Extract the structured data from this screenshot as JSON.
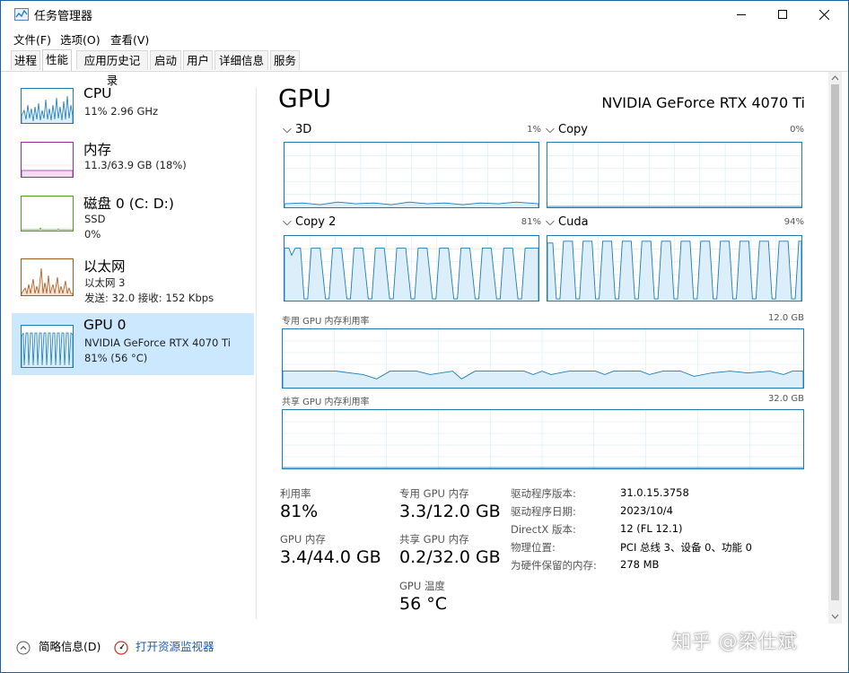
{
  "window": {
    "title": "任务管理器"
  },
  "menu": {
    "file": "文件(F)",
    "options": "选项(O)",
    "view": "查看(V)"
  },
  "tabs": [
    "进程",
    "性能",
    "应用历史记录",
    "启动",
    "用户",
    "详细信息",
    "服务"
  ],
  "active_tab": "性能",
  "sidebar": {
    "items": [
      {
        "title": "CPU",
        "sub1": "11% 2.96 GHz",
        "sub2": "",
        "sub3": "",
        "color": "#1b7cb4"
      },
      {
        "title": "内存",
        "sub1": "11.3/63.9 GB (18%)",
        "sub2": "",
        "sub3": "",
        "color": "#9b2a9b"
      },
      {
        "title": "磁盘 0 (C: D:)",
        "sub1": "SSD",
        "sub2": "0%",
        "sub3": "",
        "color": "#4da01b"
      },
      {
        "title": "以太网",
        "sub1": "以太网 3",
        "sub2": "发送: 32.0 接收: 152 Kbps",
        "sub3": "",
        "color": "#a7581b"
      },
      {
        "title": "GPU 0",
        "sub1": "NVIDIA GeForce RTX 4070 Ti",
        "sub2": "81% (56 °C)",
        "sub3": "",
        "color": "#1b7cb4"
      }
    ]
  },
  "main": {
    "title": "GPU",
    "gpu_name": "NVIDIA GeForce RTX 4070 Ti",
    "engines": [
      {
        "label": "3D",
        "pct": "1%"
      },
      {
        "label": "Copy",
        "pct": "0%"
      },
      {
        "label": "Copy 2",
        "pct": "81%"
      },
      {
        "label": "Cuda",
        "pct": "94%"
      }
    ],
    "dedicated_label": "专用 GPU 内存利用率",
    "dedicated_max": "12.0 GB",
    "shared_label": "共享 GPU 内存利用率",
    "shared_max": "32.0 GB"
  },
  "stats": {
    "util_label": "利用率",
    "util_value": "81%",
    "gpu_mem_label": "GPU 内存",
    "gpu_mem_value": "3.4/44.0 GB",
    "ded_label": "专用 GPU 内存",
    "ded_value": "3.3/12.0 GB",
    "shared_label": "共享 GPU 内存",
    "shared_value": "0.2/32.0 GB",
    "temp_label": "GPU 温度",
    "temp_value": "56 °C"
  },
  "info": [
    {
      "label": "驱动程序版本:",
      "value": "31.0.15.3758"
    },
    {
      "label": "驱动程序日期:",
      "value": "2023/10/4"
    },
    {
      "label": "DirectX 版本:",
      "value": "12 (FL 12.1)"
    },
    {
      "label": "物理位置:",
      "value": "PCI 总线 3、设备 0、功能 0"
    },
    {
      "label": "为硬件保留的内存:",
      "value": "278 MB"
    }
  ],
  "footer": {
    "summary": "简略信息(D)",
    "monitor": "打开资源监视器"
  },
  "watermark": "知乎 @梁仕斌",
  "colors": {
    "accent": "#1b7cb4",
    "selected_bg": "#cce8ff"
  }
}
